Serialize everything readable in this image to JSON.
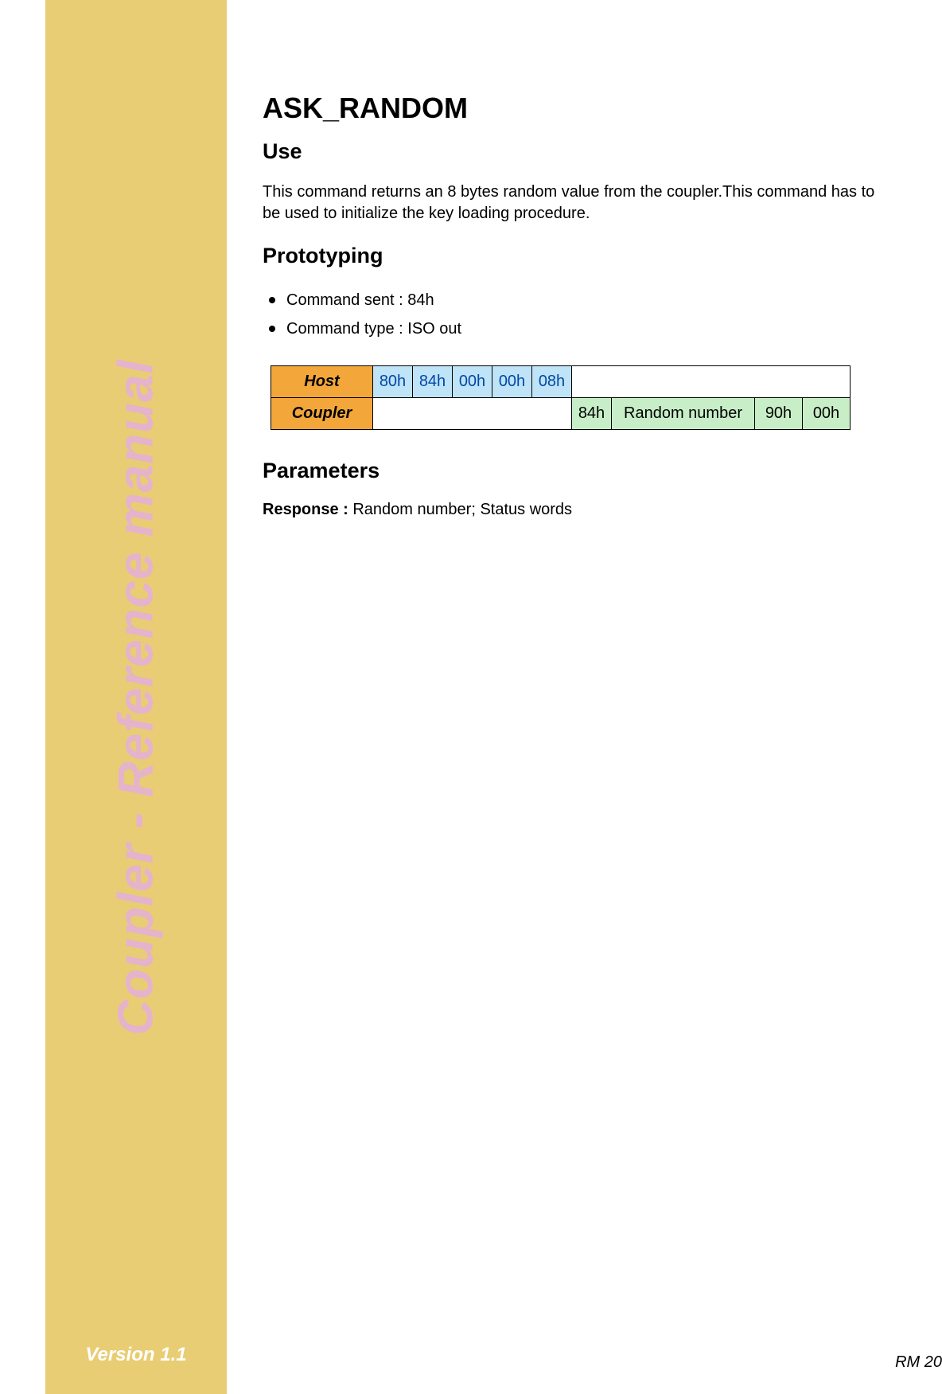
{
  "sidebar": {
    "title": "Coupler - Reference manual",
    "version": "Version 1.1"
  },
  "page": {
    "title": "ASK_RANDOM",
    "footer_page": "RM 20"
  },
  "sections": {
    "use": {
      "heading": "Use",
      "body": "This command returns an 8 bytes random value from the coupler.This command has to be used to initialize the key loading procedure."
    },
    "prototyping": {
      "heading": "Prototyping",
      "bullets": [
        "Command sent : 84h",
        "Command type : ISO out"
      ],
      "table": {
        "host_label": "Host",
        "coupler_label": "Coupler",
        "host_bytes": [
          "80h",
          "84h",
          "00h",
          "00h",
          "08h"
        ],
        "coupler_bytes": [
          "84h",
          "Random number",
          "90h",
          "00h"
        ]
      }
    },
    "parameters": {
      "heading": "Parameters",
      "response_label": "Response : ",
      "response_value": "Random number; Status words"
    }
  }
}
